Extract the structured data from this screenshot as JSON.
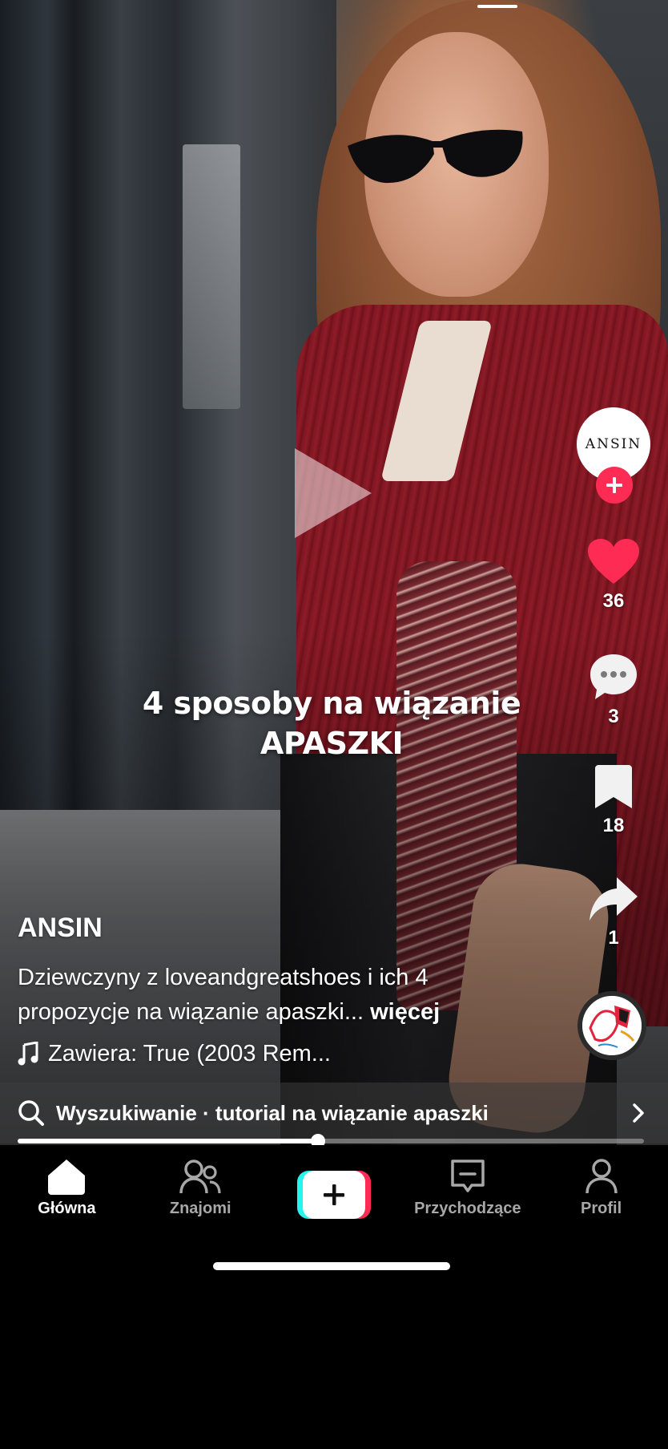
{
  "video": {
    "overlay_line1": "4 sposoby na wiązanie",
    "overlay_line2": "APASZKI",
    "progress_fraction": 0.48
  },
  "creator": {
    "avatar_text": "ANSIN",
    "username": "ANSIN"
  },
  "actions": {
    "likes": "36",
    "comments": "3",
    "saves": "18",
    "shares": "1"
  },
  "caption": {
    "text": "Dziewczyny z loveandgreatshoes i ich 4 propozycje na wiązanie apaszki...",
    "more_label": "więcej"
  },
  "music": {
    "label": "Zawiera: True (2003 Rem..."
  },
  "search_bar": {
    "label": "Wyszukiwanie · tutorial na wiązanie apaszki"
  },
  "bottom_nav": {
    "items": [
      {
        "label": "Główna",
        "icon": "home-icon",
        "active": true
      },
      {
        "label": "Znajomi",
        "icon": "friends-icon"
      },
      {
        "label": "",
        "icon": "create-plus-icon"
      },
      {
        "label": "Przychodzące",
        "icon": "inbox-icon"
      },
      {
        "label": "Profil",
        "icon": "profile-icon"
      }
    ]
  },
  "colors": {
    "accent": "#fe2c55",
    "cyan": "#25f4ee",
    "heart": "#fe2c55"
  }
}
